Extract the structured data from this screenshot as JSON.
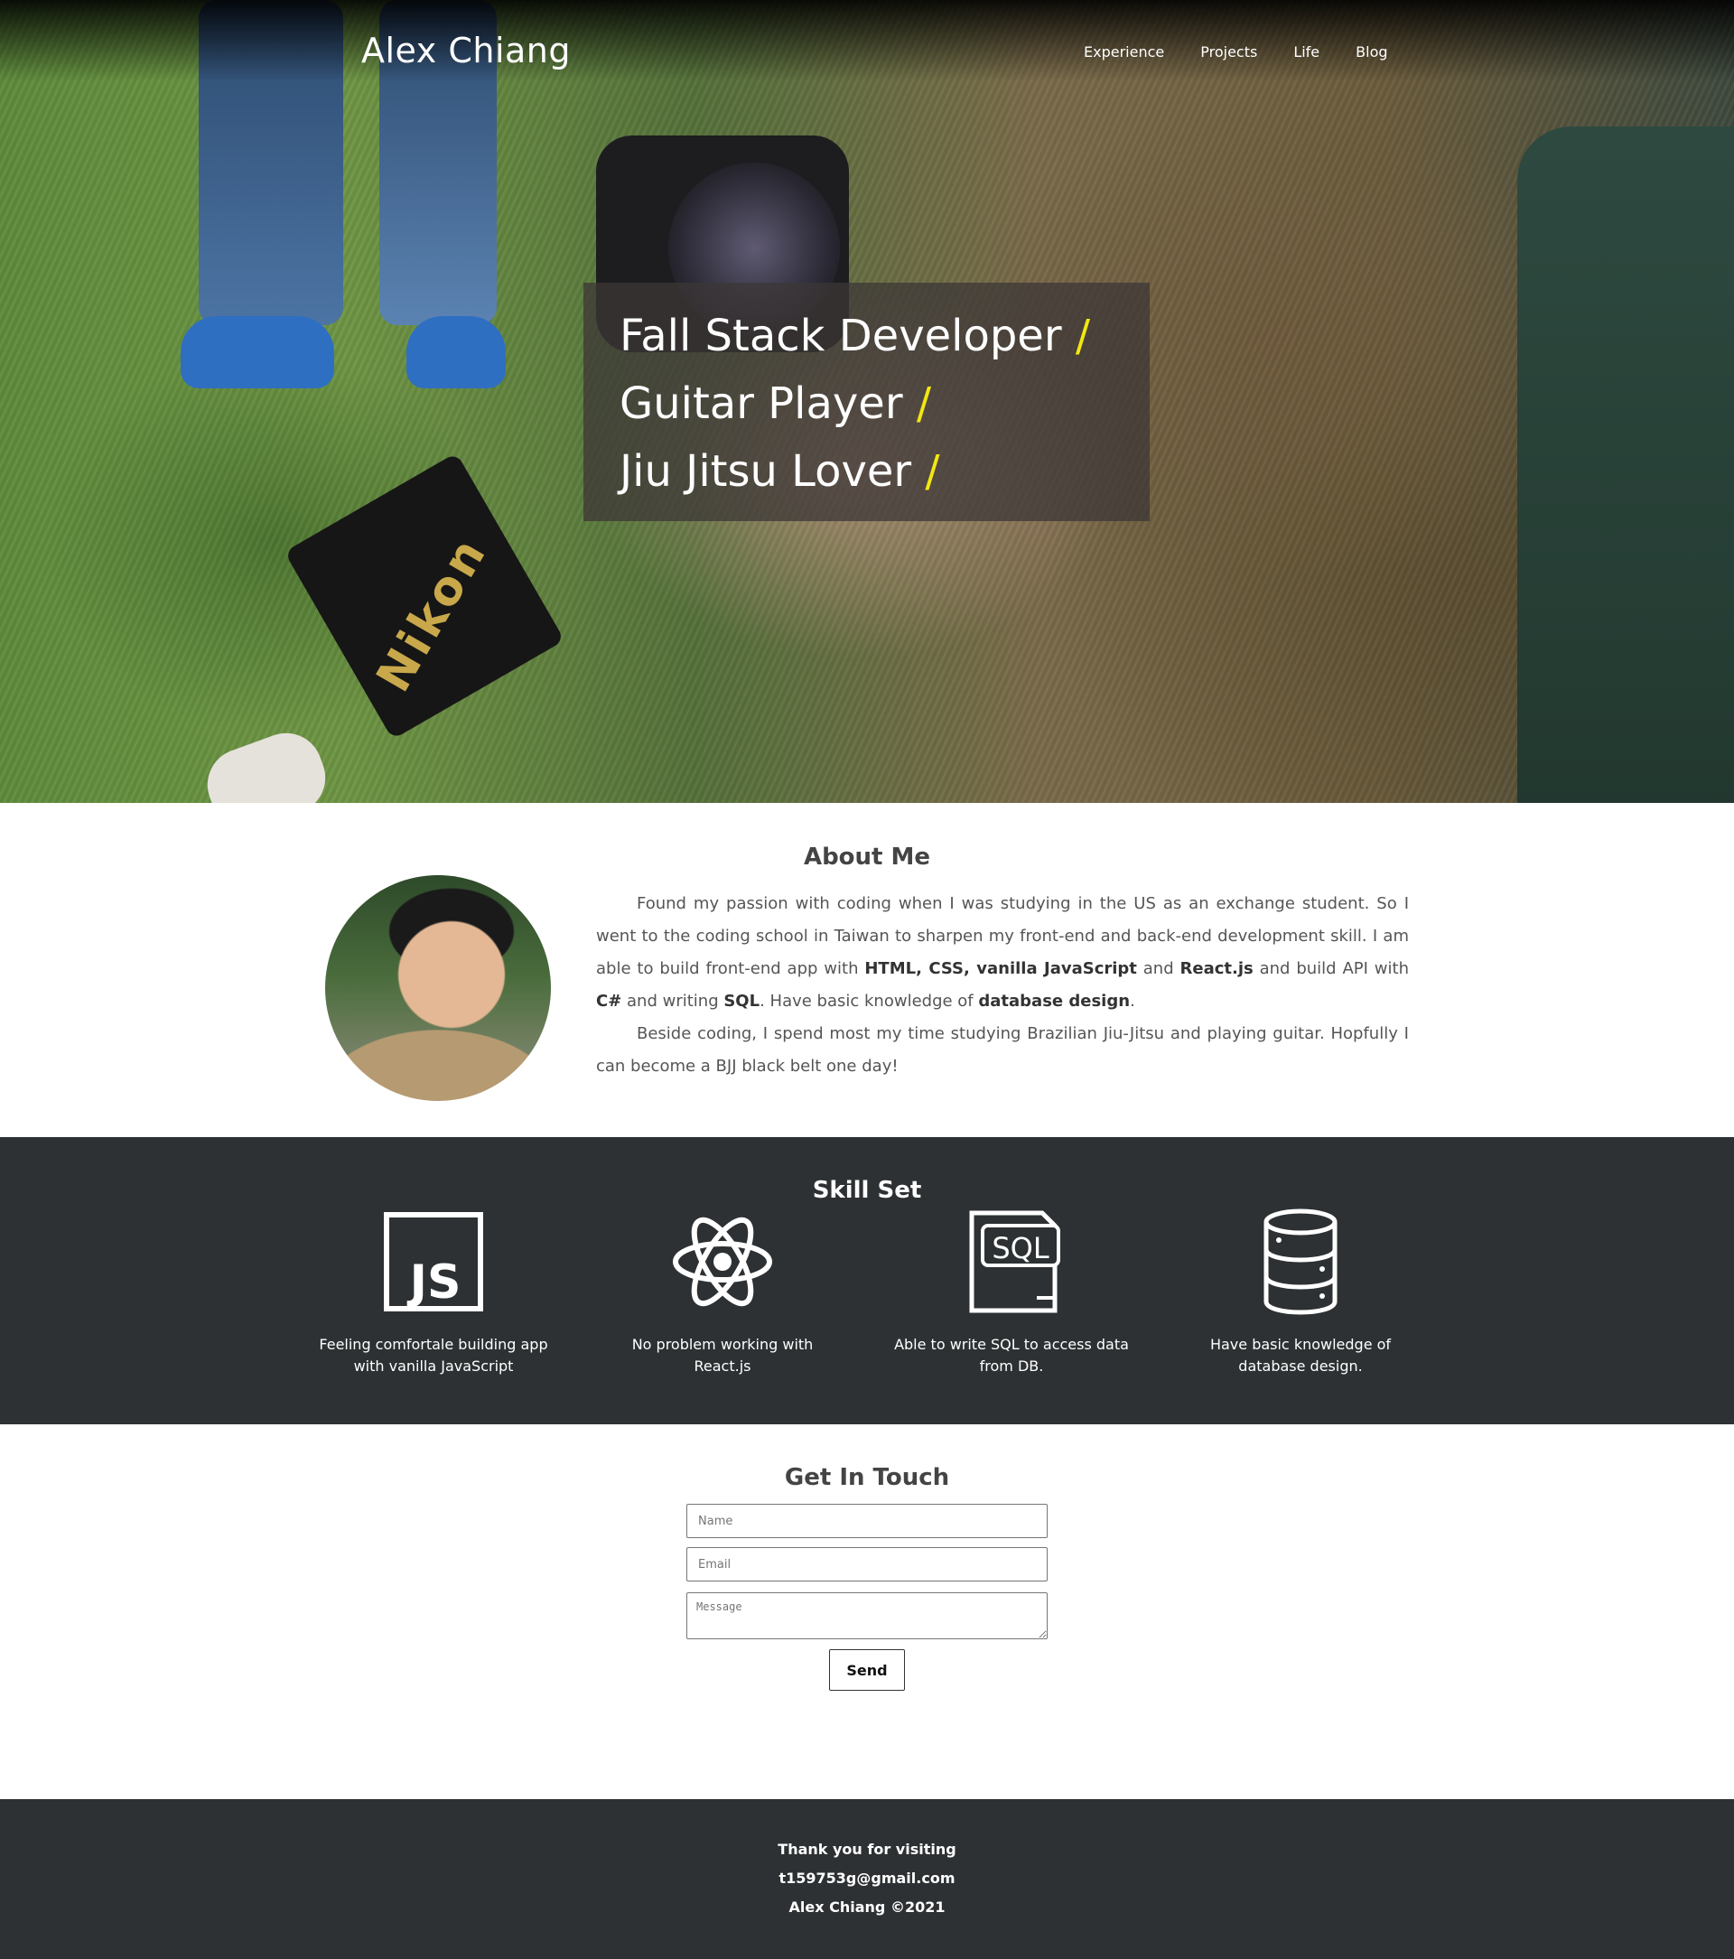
{
  "site": {
    "brand": "Alex Chiang"
  },
  "nav": {
    "items": [
      {
        "label": "Experience"
      },
      {
        "label": "Projects"
      },
      {
        "label": "Life"
      },
      {
        "label": "Blog"
      }
    ]
  },
  "hero": {
    "lines": [
      {
        "text": "Fall Stack Developer",
        "slash": "/"
      },
      {
        "text": "Guitar Player",
        "slash": "/"
      },
      {
        "text": "Jiu Jitsu Lover",
        "slash": "/"
      }
    ],
    "accent_color": "#f2e711",
    "photo_strap_text": "Nikon"
  },
  "about": {
    "title": "About Me",
    "p1": {
      "a": "Found my passion with coding when I was studying in the US as an exchange student. So I went to the coding school in Taiwan to sharpen my front-end and back-end development skill. I am able to build front-end app with ",
      "b1": "HTML, CSS, vanilla JavaScript",
      "c": " and ",
      "b2": "React.js",
      "d": " and build API with ",
      "b3": "C#",
      "e": " and writing ",
      "b4": "SQL",
      "f": ". Have basic knowledge of ",
      "b5": "database design",
      "g": "."
    },
    "p2": "Beside coding, I spend most my time studying Brazilian Jiu-Jitsu and playing guitar. Hopfully I can become a BJJ black belt one day!"
  },
  "skills": {
    "title": "Skill Set",
    "items": [
      {
        "icon": "javascript-icon",
        "text": "Feeling comfortale building app with vanilla JavaScript"
      },
      {
        "icon": "react-icon",
        "text": "No problem working with React.js"
      },
      {
        "icon": "sql-icon",
        "text": "Able to write SQL to access data from DB."
      },
      {
        "icon": "database-icon",
        "text": "Have basic knowledge of database design."
      }
    ],
    "icon_labels": {
      "js": "JS",
      "sql": "SQL"
    }
  },
  "contact": {
    "title": "Get In Touch",
    "name_placeholder": "Name",
    "email_placeholder": "Email",
    "message_placeholder": "Message",
    "send_label": "Send"
  },
  "footer": {
    "line1": "Thank you for visiting",
    "line2": "t159753g@gmail.com",
    "line3": "Alex Chiang ©2021"
  },
  "colors": {
    "dark_section": "#2d3133",
    "hero_overlay": "#3c3737",
    "accent": "#f2e711"
  }
}
